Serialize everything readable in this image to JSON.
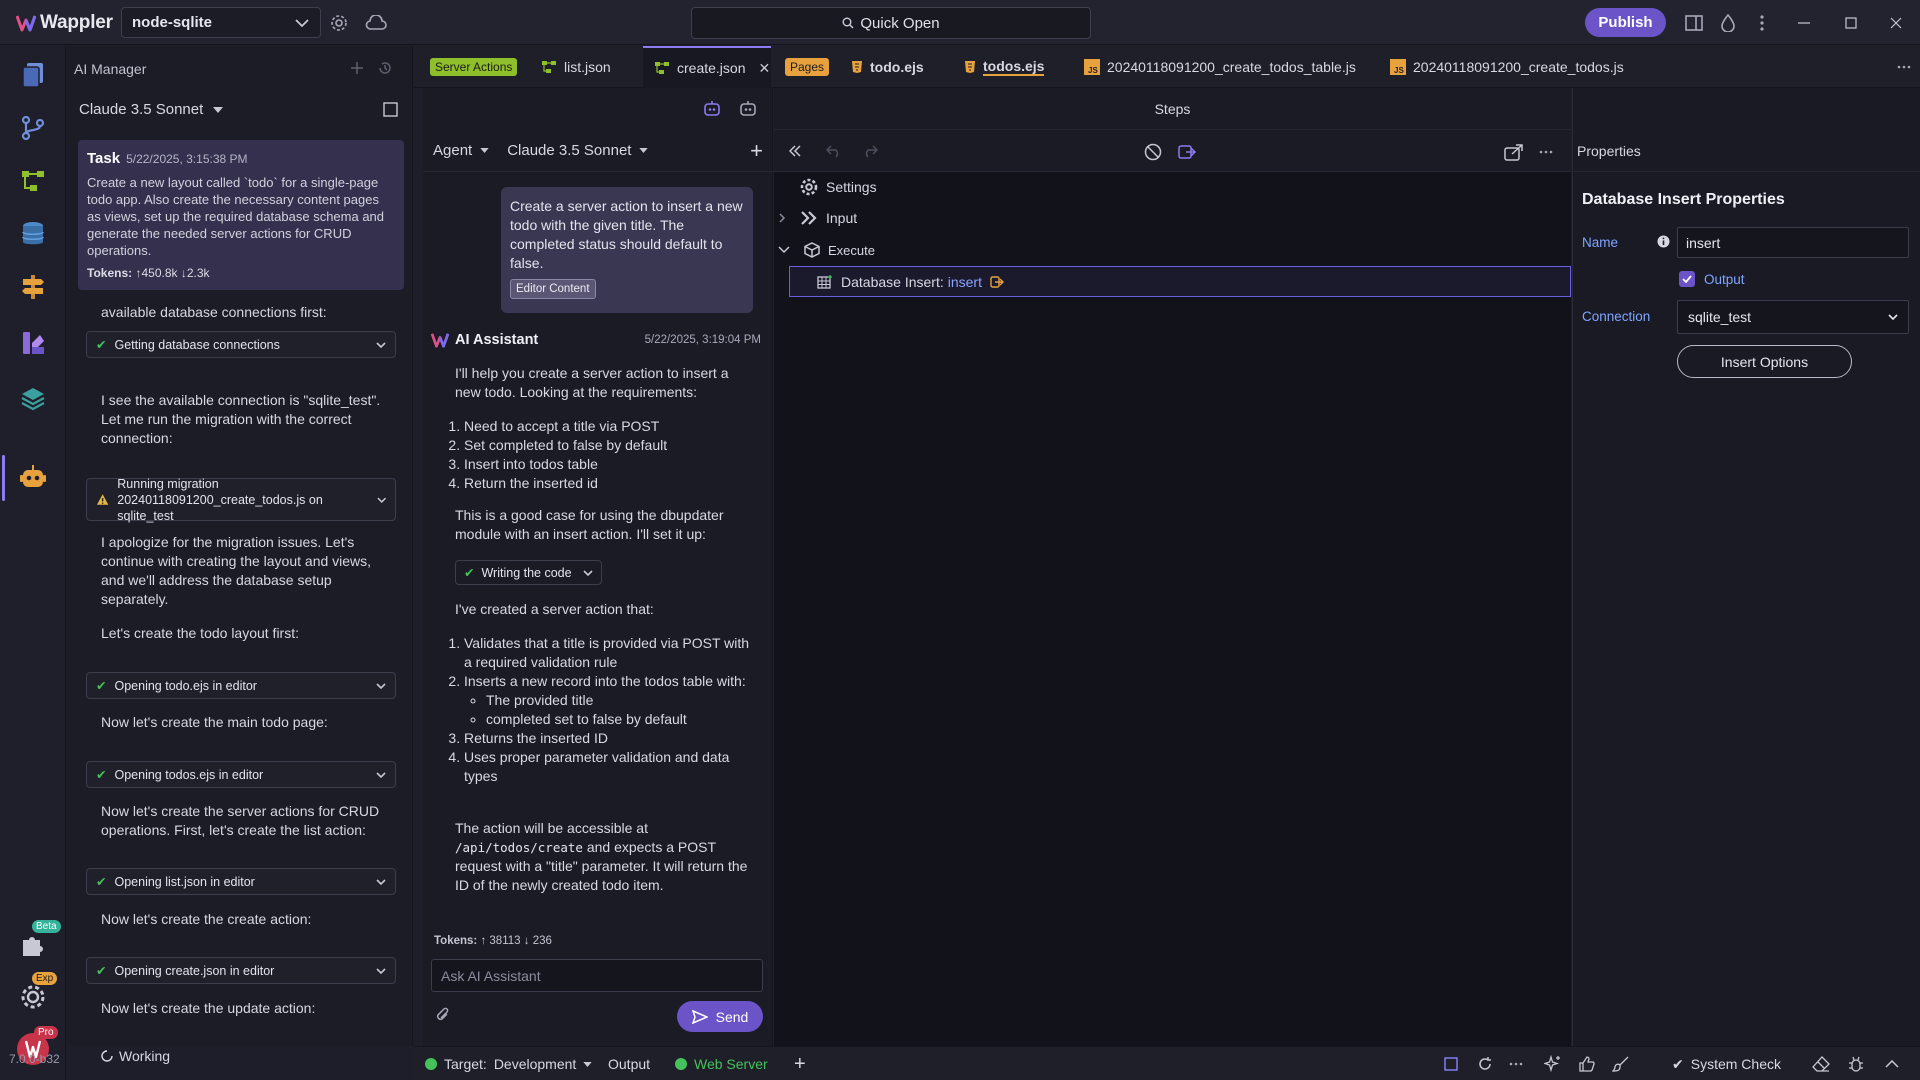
{
  "app": {
    "name": "Wappler",
    "project": "node-sqlite",
    "quick_open": "Quick Open",
    "publish": "Publish",
    "version": "7.0.0-b32"
  },
  "activity": {
    "beta": "Beta",
    "exp": "Exp",
    "pro": "Pro"
  },
  "ai_manager": {
    "title": "AI Manager",
    "model": "Claude 3.5 Sonnet",
    "task": {
      "label": "Task",
      "timestamp": "5/22/2025, 3:15:38 PM",
      "text": "Create a new layout called `todo` for a single-page todo app. Also create the necessary content pages as views, set up the required database schema and generate the needed server actions for CRUD operations.",
      "tokens_label": "Tokens:",
      "tokens_up": "450.8k",
      "tokens_down": "2.3k"
    },
    "messages": [
      "available database connections first:",
      "I see the available connection is \"sqlite_test\". Let me run the migration with the correct connection:",
      "I apologize for the migration issues. Let's continue with creating the layout and views, and we'll address the database setup separately.",
      "Let's create the todo layout first:",
      "Now let's create the main todo page:",
      "Now let's create the server actions for CRUD operations. First, let's create the list action:",
      "Now let's create the create action:",
      "Now let's create the update action:"
    ],
    "steps": [
      "Getting database connections",
      "Running migration",
      "20240118091200_create_todos.js on sqlite_test",
      "Opening todo.ejs in editor",
      "Opening todos.ejs in editor",
      "Opening list.json in editor",
      "Opening create.json in editor"
    ],
    "working": "Working"
  },
  "tabs": {
    "server_actions": "Server Actions",
    "list": "list.json",
    "create": "create.json",
    "pages": "Pages",
    "todo": "todo.ejs",
    "todos": "todos.ejs",
    "migration1": "20240118091200_create_todos_table.js",
    "migration2": "20240118091200_create_todos.js"
  },
  "chat": {
    "mode": "Agent",
    "model": "Claude 3.5 Sonnet",
    "user_message": "Create a server action to insert a new todo with the given title. The completed status should default to false.",
    "editor_content": "Editor Content",
    "assistant_name": "AI Assistant",
    "assistant_time": "5/22/2025, 3:19:04 PM",
    "intro": "I'll help you create a server action to insert a new todo. Looking at the requirements:",
    "requirements": [
      "Need to accept a title via POST",
      "Set completed to false by default",
      "Insert into todos table",
      "Return the inserted id"
    ],
    "plan": "This is a good case for using the dbupdater module with an insert action. I'll set it up:",
    "writing": "Writing the code",
    "created": "I've created a server action that:",
    "summary": [
      "Validates that a title is provided via POST with a required validation rule",
      "Inserts a new record into the todos table with:",
      "Returns the inserted ID",
      "Uses proper parameter validation and data types"
    ],
    "summary_sub": [
      "The provided title",
      "completed set to false by default"
    ],
    "closing_1": "The action will be accessible at",
    "closing_code": "/api/todos/create",
    "closing_2": "and expects a POST request with a \"title\" parameter. It will return the ID of the newly created todo item.",
    "tokens_label": "Tokens:",
    "tokens_up": "38113",
    "tokens_down": "236",
    "input_placeholder": "Ask AI Assistant",
    "send": "Send"
  },
  "steps_panel": {
    "title": "Steps",
    "settings": "Settings",
    "input": "Input",
    "execute": "Execute",
    "db_insert_label": "Database Insert:",
    "db_insert_name": "insert"
  },
  "properties": {
    "header": "Properties",
    "title": "Database Insert Properties",
    "name_label": "Name",
    "name_value": "insert",
    "output_label": "Output",
    "connection_label": "Connection",
    "connection_value": "sqlite_test",
    "insert_options": "Insert Options"
  },
  "statusbar": {
    "target_label": "Target:",
    "target_value": "Development",
    "output": "Output",
    "web_server": "Web Server",
    "system_check": "System Check"
  },
  "colors": {
    "accent": "#6a54c8",
    "link": "#8aa4ff",
    "server_actions_tag": "#8fbf2a",
    "pages_tag": "#e7a23e",
    "status_ok": "#45c25a"
  }
}
